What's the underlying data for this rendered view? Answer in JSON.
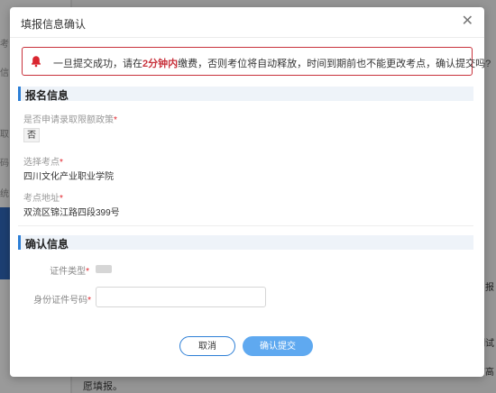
{
  "background": {
    "side_texts": [
      "考",
      "信",
      "取",
      "码",
      "统"
    ],
    "bottom_text": "愿填报。",
    "right_texts": [
      "报",
      "测试",
      "有高"
    ]
  },
  "modal": {
    "title": "填报信息确认",
    "close_icon": "close-icon",
    "warning": {
      "icon": "bell-icon",
      "text_before": "一旦提交成功，请在",
      "highlight": "2分钟内",
      "text_after": "缴费，否则考位将自动释放，时间到期前也不能更改考点，确认提交吗?"
    },
    "sections": {
      "registration": "报名信息",
      "confirm": "确认信息"
    },
    "fields": {
      "quota_policy_label": "是否申请录取限额政策",
      "quota_policy_value": "否",
      "exam_site_label": "选择考点",
      "exam_site_value": "四川文化产业职业学院",
      "address_label": "考点地址",
      "address_value": "双流区锦江路四段399号",
      "id_type_label": "证件类型",
      "id_number_label": "身份证件号码",
      "id_number_value": "",
      "required_mark": "*"
    },
    "buttons": {
      "cancel": "取消",
      "confirm": "确认提交"
    }
  }
}
